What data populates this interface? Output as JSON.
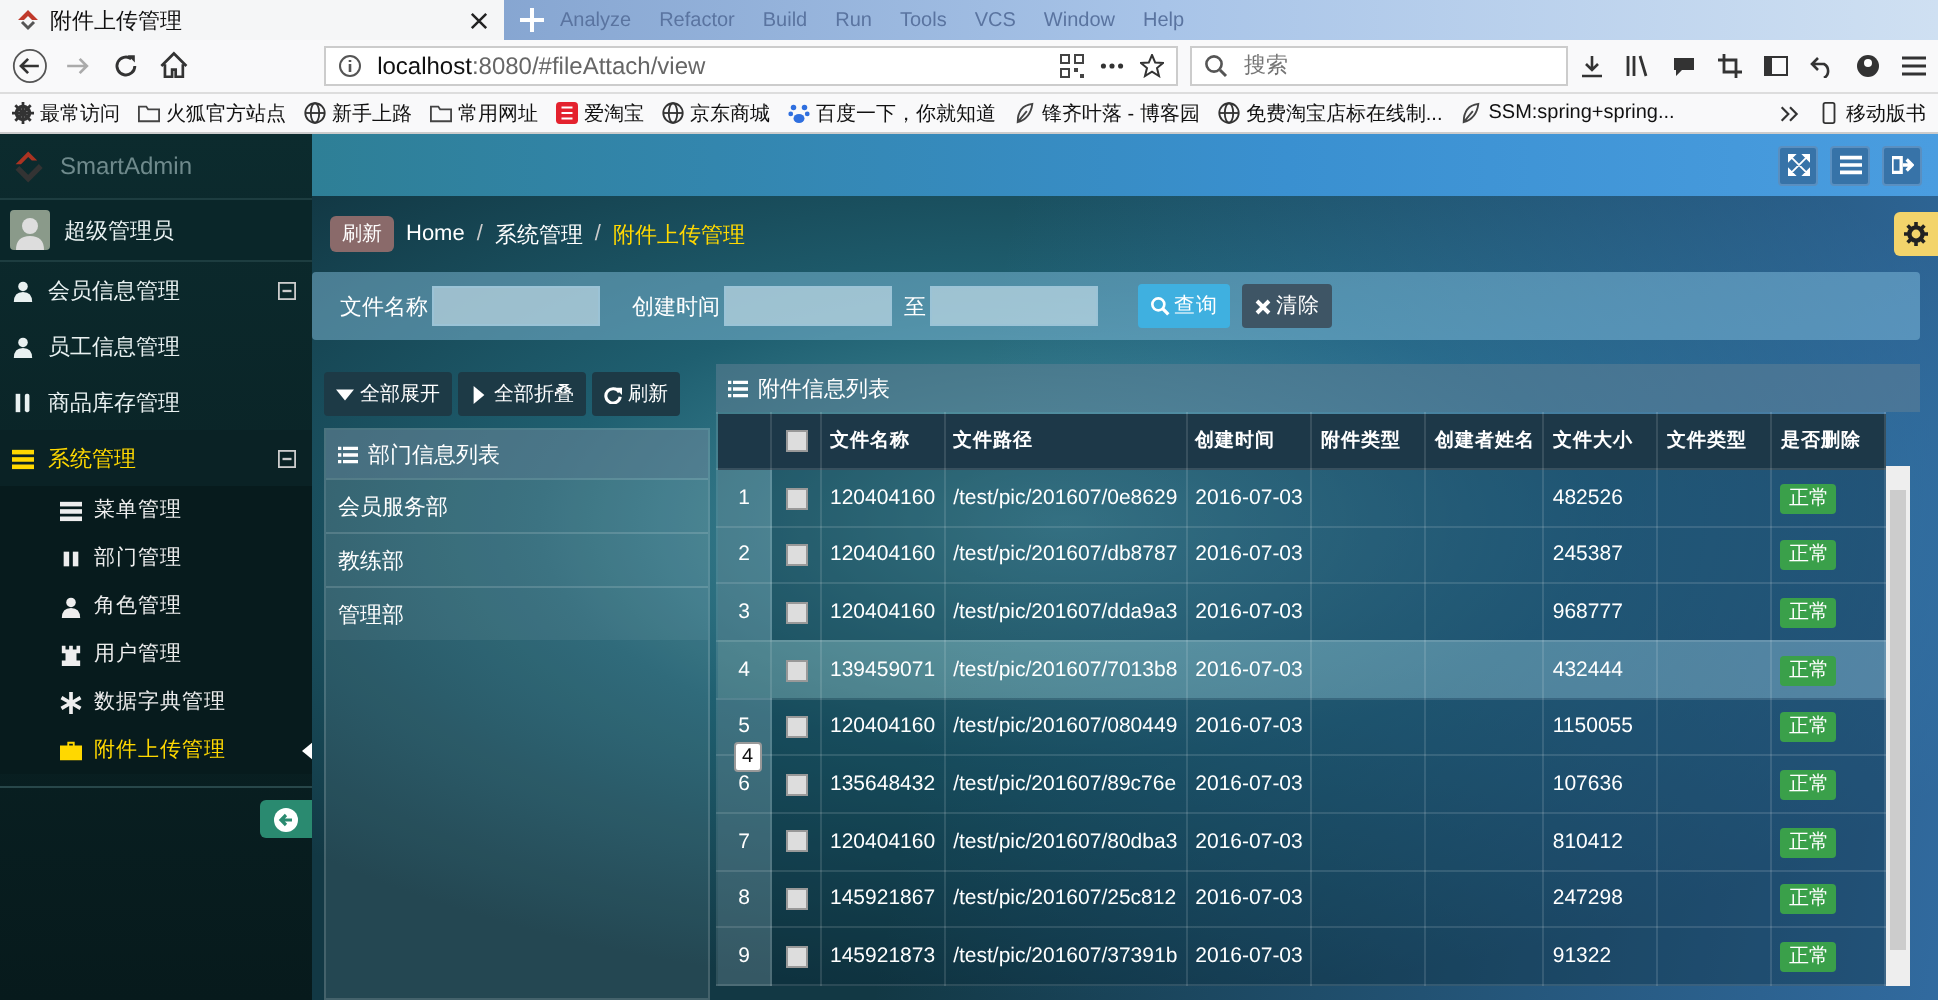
{
  "browser": {
    "tab_title": "附件上传管理",
    "background_menu": [
      "Analyze",
      "Refactor",
      "Build",
      "Run",
      "Tools",
      "VCS",
      "Window",
      "Help"
    ],
    "address_host": "localhost",
    "address_rest": ":8080/#fileAttach/view",
    "search_placeholder": "搜索",
    "bookmarks": [
      {
        "label": "最常访问",
        "kind": "gear"
      },
      {
        "label": "火狐官方站点",
        "kind": "folder"
      },
      {
        "label": "新手上路",
        "kind": "globe"
      },
      {
        "label": "常用网址",
        "kind": "folder"
      },
      {
        "label": "爱淘宝",
        "kind": "badge"
      },
      {
        "label": "京东商城",
        "kind": "globe"
      },
      {
        "label": "百度一下，你就知道",
        "kind": "paw"
      },
      {
        "label": "锋齐叶落 - 博客园",
        "kind": "leaf"
      },
      {
        "label": "免费淘宝店标在线制...",
        "kind": "globe"
      },
      {
        "label": "SSM:spring+spring...",
        "kind": "leaf"
      }
    ],
    "mobile_bookmarks": "移动版书"
  },
  "sidebar": {
    "brand": "SmartAdmin",
    "user": "超级管理员",
    "menu": [
      {
        "label": "会员信息管理",
        "expanded": true,
        "selected": false
      },
      {
        "label": "员工信息管理",
        "selected": false
      },
      {
        "label": "商品库存管理",
        "selected": false
      },
      {
        "label": "系统管理",
        "expanded": true,
        "selected": true,
        "children": [
          {
            "label": "菜单管理",
            "selected": false
          },
          {
            "label": "部门管理",
            "selected": false
          },
          {
            "label": "角色管理",
            "selected": false
          },
          {
            "label": "用户管理",
            "selected": false
          },
          {
            "label": "数据字典管理",
            "selected": false
          },
          {
            "label": "附件上传管理",
            "selected": true
          }
        ]
      }
    ]
  },
  "breadcrumb": {
    "refresh": "刷新",
    "items": [
      "Home",
      "系统管理",
      "附件上传管理"
    ],
    "separator": "/"
  },
  "filter": {
    "name_label": "文件名称",
    "time_label": "创建时间",
    "to_label": "至",
    "search_button": "查询",
    "clear_button": "清除"
  },
  "tree_buttons": [
    "全部展开",
    "全部折叠",
    "刷新"
  ],
  "dept_panel": {
    "title": "部门信息列表",
    "items": [
      "会员服务部",
      "教练部",
      "管理部"
    ]
  },
  "attach_panel": {
    "title": "附件信息列表",
    "select_all_checked": false,
    "columns": [
      "文件名称",
      "文件路径",
      "创建时间",
      "附件类型",
      "创建者姓名",
      "文件大小",
      "文件类型",
      "是否删除"
    ],
    "rows": [
      {
        "no": "1",
        "checked": false,
        "highlighted": false,
        "cells": [
          "120404160",
          "/test/pic/201607/0e8629",
          "2016-07-03",
          "",
          "",
          "482526",
          ""
        ],
        "status": "正常"
      },
      {
        "no": "2",
        "checked": false,
        "highlighted": false,
        "cells": [
          "120404160",
          "/test/pic/201607/db8787",
          "2016-07-03",
          "",
          "",
          "245387",
          ""
        ],
        "status": "正常"
      },
      {
        "no": "3",
        "checked": false,
        "highlighted": false,
        "cells": [
          "120404160",
          "/test/pic/201607/dda9a3",
          "2016-07-03",
          "",
          "",
          "968777",
          ""
        ],
        "status": "正常"
      },
      {
        "no": "4",
        "checked": false,
        "highlighted": true,
        "cells": [
          "139459071",
          "/test/pic/201607/7013b8",
          "2016-07-03",
          "",
          "",
          "432444",
          ""
        ],
        "status": "正常"
      },
      {
        "no": "5",
        "checked": false,
        "highlighted": false,
        "cells": [
          "120404160",
          "/test/pic/201607/080449",
          "2016-07-03",
          "",
          "",
          "1150055",
          ""
        ],
        "status": "正常"
      },
      {
        "no": "6",
        "checked": false,
        "highlighted": false,
        "cells": [
          "135648432",
          "/test/pic/201607/89c76e",
          "2016-07-03",
          "",
          "",
          "107636",
          ""
        ],
        "status": "正常"
      },
      {
        "no": "7",
        "checked": false,
        "highlighted": false,
        "cells": [
          "120404160",
          "/test/pic/201607/80dba3",
          "2016-07-03",
          "",
          "",
          "810412",
          ""
        ],
        "status": "正常"
      },
      {
        "no": "8",
        "checked": false,
        "highlighted": false,
        "cells": [
          "145921867",
          "/test/pic/201607/25c812",
          "2016-07-03",
          "",
          "",
          "247298",
          ""
        ],
        "status": "正常"
      },
      {
        "no": "9",
        "checked": false,
        "highlighted": false,
        "cells": [
          "145921873",
          "/test/pic/201607/37391b",
          "2016-07-03",
          "",
          "",
          "91322",
          ""
        ],
        "status": "正常"
      }
    ],
    "tooltip": "4"
  }
}
